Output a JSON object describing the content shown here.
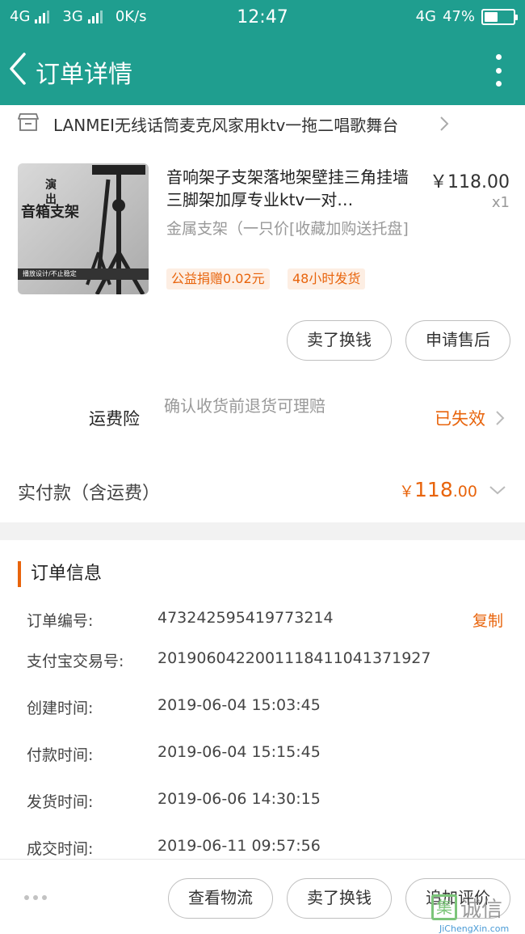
{
  "status_bar": {
    "network_1": "4G",
    "network_2": "3G",
    "speed": "0K/s",
    "time": "12:47",
    "network_right": "4G",
    "battery": "47%",
    "battery_level": 0.47
  },
  "header": {
    "title": "订单详情"
  },
  "shop": {
    "name": "LANMEI无线话筒麦克风家用ktv一拖二唱歌舞台"
  },
  "product": {
    "image_text_line1": "演",
    "image_text_line2": "出",
    "image_text_line3": "音箱支架",
    "image_strip": "播放设计/不止稳定",
    "title": "音响架子支架落地架壁挂三角挂墙三脚架加厚专业ktv一对…",
    "price": "￥118.00",
    "quantity": "x1",
    "spec": "金属支架（一只价[收藏加购送托盘]",
    "tags": [
      "公益捐赠0.02元",
      "48小时发货"
    ]
  },
  "product_actions": {
    "resell": "卖了换钱",
    "after_sale": "申请售后"
  },
  "insurance": {
    "label": "运费险",
    "description": "确认收货前退货可理赔",
    "status": "已失效"
  },
  "payment": {
    "label": "实付款（含运费）",
    "currency": "￥",
    "amount_int": "118",
    "amount_dec": ".00"
  },
  "order_info": {
    "title": "订单信息",
    "copy_label": "复制",
    "rows": [
      {
        "label": "订单编号:",
        "value": "473242595419773214"
      },
      {
        "label": "支付宝交易号:",
        "value": "2019060422001118411041371927"
      },
      {
        "label": "创建时间:",
        "value": "2019-06-04 15:03:45"
      },
      {
        "label": "付款时间:",
        "value": "2019-06-04 15:15:45"
      },
      {
        "label": "发货时间:",
        "value": "2019-06-06 14:30:15"
      },
      {
        "label": "成交时间:",
        "value": "2019-06-11 09:57:56"
      }
    ]
  },
  "bottom_bar": {
    "logistics": "查看物流",
    "resell": "卖了换钱",
    "add_review": "追加评价"
  },
  "watermark": {
    "logo_char": "集",
    "text_cn": "诚信",
    "text_en": "JiChengXin.com"
  },
  "colors": {
    "brand": "#1f9e8f",
    "accent": "#e8640c"
  }
}
